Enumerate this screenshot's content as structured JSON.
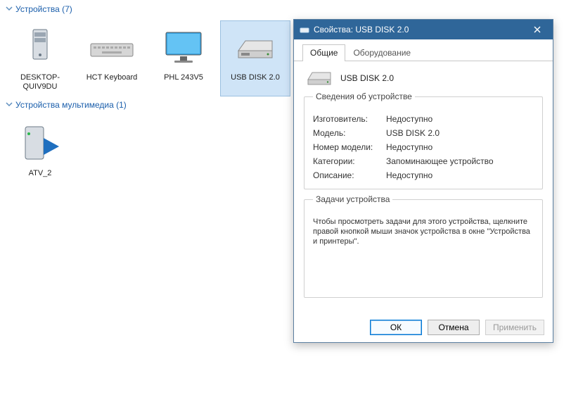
{
  "sections": {
    "devices": {
      "title": "Устройства (7)"
    },
    "multimedia": {
      "title": "Устройства мультимедиа (1)"
    }
  },
  "devices": [
    {
      "label": "DESKTOP-QUIV9DU"
    },
    {
      "label": "HCT Keyboard"
    },
    {
      "label": "PHL 243V5"
    },
    {
      "label": "USB DISK 2.0"
    }
  ],
  "multimedia": [
    {
      "label": "ATV_2"
    }
  ],
  "dialog": {
    "title": "Свойства: USB DISK 2.0",
    "tabs": {
      "general": "Общие",
      "hardware": "Оборудование"
    },
    "device_name": "USB DISK 2.0",
    "info_legend": "Сведения об устройстве",
    "props": {
      "manufacturer_k": "Изготовитель:",
      "manufacturer_v": "Недоступно",
      "model_k": "Модель:",
      "model_v": "USB DISK 2.0",
      "model_no_k": "Номер модели:",
      "model_no_v": "Недоступно",
      "categories_k": "Категории:",
      "categories_v": "Запоминающее устройство",
      "description_k": "Описание:",
      "description_v": "Недоступно"
    },
    "tasks_legend": "Задачи устройства",
    "tasks_text": "Чтобы просмотреть задачи для этого устройства, щелкните правой кнопкой мыши значок устройства в окне \"Устройства и принтеры\".",
    "buttons": {
      "ok": "ОК",
      "cancel": "Отмена",
      "apply": "Применить"
    }
  }
}
